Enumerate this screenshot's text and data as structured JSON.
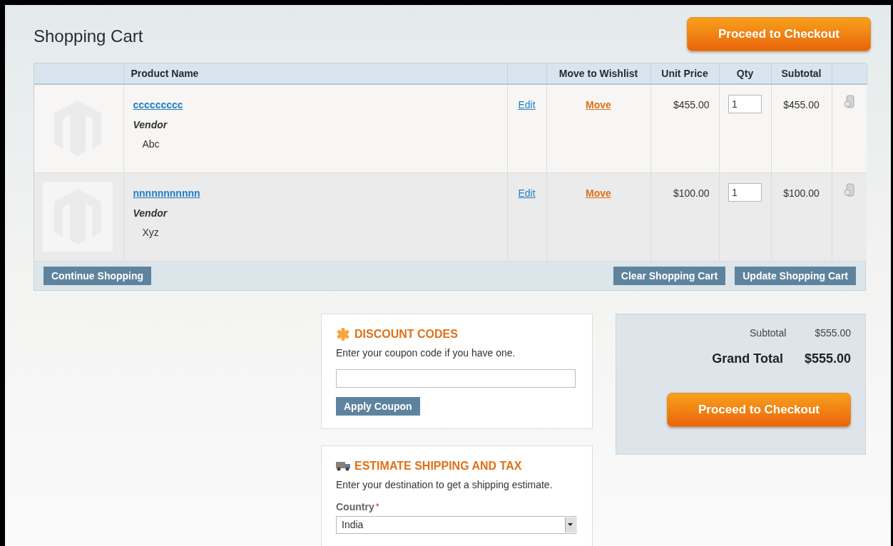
{
  "page_title": "Shopping Cart",
  "top_checkout_button": "Proceed to Checkout",
  "table": {
    "columns": [
      "",
      "Product Name",
      "",
      "Move to Wishlist",
      "Unit Price",
      "Qty",
      "Subtotal",
      ""
    ],
    "rows": [
      {
        "product_name": "ccccccccc",
        "option_label": "Vendor",
        "option_value": "Abc",
        "edit": "Edit",
        "move": "Move",
        "unit_price": "$455.00",
        "qty": "1",
        "subtotal": "$455.00"
      },
      {
        "product_name": "nnnnnnnnnnn",
        "option_label": "Vendor",
        "option_value": "Xyz",
        "edit": "Edit",
        "move": "Move",
        "unit_price": "$100.00",
        "qty": "1",
        "subtotal": "$100.00"
      }
    ],
    "footer_buttons": {
      "continue": "Continue Shopping",
      "clear": "Clear Shopping Cart",
      "update": "Update Shopping Cart"
    }
  },
  "discount": {
    "title": "DISCOUNT CODES",
    "text": "Enter your coupon code if you have one.",
    "button": "Apply Coupon"
  },
  "shipping": {
    "title": "ESTIMATE SHIPPING AND TAX",
    "text": "Enter your destination to get a shipping estimate.",
    "country_label": "Country",
    "required_mark": "*",
    "country_value": "India"
  },
  "totals": {
    "subtotal_label": "Subtotal",
    "subtotal_value": "$555.00",
    "grand_total_label": "Grand Total",
    "grand_total_value": "$555.00",
    "checkout_button": "Proceed to Checkout"
  }
}
